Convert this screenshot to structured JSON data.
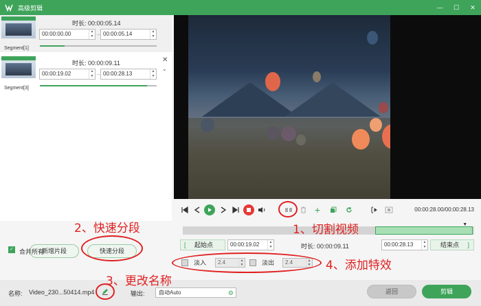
{
  "window": {
    "title": "高级剪辑",
    "minimize": "—",
    "maximize": "☐",
    "close": "✕"
  },
  "segments": [
    {
      "name": "Segment[1]",
      "duration_label": "时长: 00:00:05.14",
      "start": "00:00:00.00",
      "end": "00:00:05.14",
      "progress": 0.21
    },
    {
      "name": "Segment[3]",
      "duration_label": "时长: 00:00:09.11",
      "start": "00:00:19.02",
      "end": "00:00:28.13",
      "progress": 0.92,
      "close": "✕",
      "chevron": "⌄"
    }
  ],
  "dash": "–",
  "player": {
    "time": "00:00:28.00/00:00:28.13"
  },
  "timeline": {
    "selection_start": 0.66,
    "selection_end": 1.0,
    "playhead": 0.97
  },
  "trim": {
    "start_button": "起始点",
    "start_value": "00:00:19.02",
    "duration_label": "时长: 00:00:09.11",
    "end_value": "00:00:28.13",
    "end_button": "结束点",
    "bracket_open": "[",
    "bracket_close": "]"
  },
  "effects": {
    "fade_in_label": "淡入",
    "fade_in_value": "2.4",
    "fade_out_label": "淡出",
    "fade_out_value": "2.4"
  },
  "buttons": {
    "new_segment": "新增片段",
    "quick_split": "快速分段",
    "merge_all": "合并所有",
    "back": "返回",
    "edit": "剪辑"
  },
  "bottom": {
    "name_label": "名称:",
    "name_value": "Video_230...50414.mp4",
    "output_label": "输出:",
    "output_value": "自动Auto"
  },
  "annotations": {
    "cut_video": "1、切割视频",
    "quick_split": "2、快速分段",
    "rename": "3、更改名称",
    "add_effects": "4、添加特效"
  },
  "colors": {
    "accent": "#3ea45a",
    "annotation": "#e02020",
    "stop": "#e53935"
  }
}
